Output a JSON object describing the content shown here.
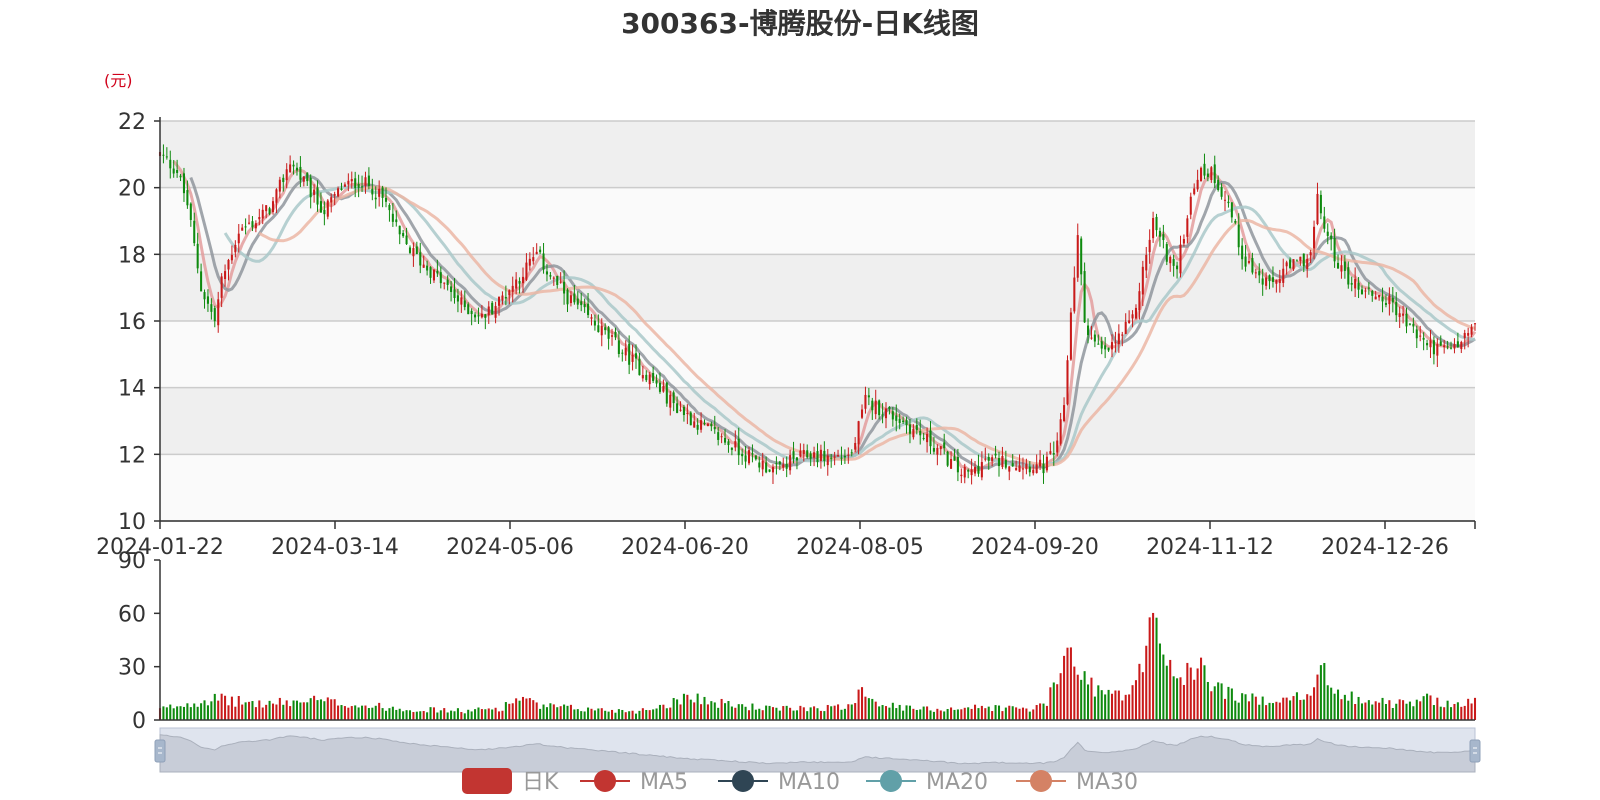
{
  "chart_data": {
    "type": "candlestick",
    "title": "300363-博腾股份-日K线图",
    "unit": "(元)",
    "colors": {
      "up": "#c91a1a",
      "down": "#0e8a0e",
      "ma5": "#e39c9c",
      "ma10": "#8f959c",
      "ma20": "#a9c8c9",
      "ma30": "#ebb6a4"
    },
    "price_axis": {
      "min": 10,
      "max": 22,
      "ticks": [
        10,
        12,
        14,
        16,
        18,
        20,
        22
      ]
    },
    "volume_axis": {
      "min": 0,
      "max": 90,
      "ticks": [
        0,
        30,
        60,
        90
      ]
    },
    "date_ticks": [
      "2024-01-22",
      "2024-03-14",
      "2024-05-06",
      "2024-06-20",
      "2024-08-05",
      "2024-09-20",
      "2024-11-12",
      "2024-12-26"
    ],
    "legend": [
      {
        "name": "日K",
        "color": "#c23531",
        "kind": "bar"
      },
      {
        "name": "MA5",
        "color": "#c23531",
        "kind": "line"
      },
      {
        "name": "MA10",
        "color": "#2f4554",
        "kind": "line"
      },
      {
        "name": "MA20",
        "color": "#61a0a8",
        "kind": "line"
      },
      {
        "name": "MA30",
        "color": "#d48265",
        "kind": "line"
      }
    ],
    "closes_anchor": [
      [
        0,
        21.0
      ],
      [
        5,
        20.5
      ],
      [
        8,
        19.5
      ],
      [
        12,
        17.0
      ],
      [
        16,
        16.0
      ],
      [
        18,
        17.2
      ],
      [
        23,
        18.7
      ],
      [
        28,
        19.0
      ],
      [
        33,
        19.5
      ],
      [
        38,
        20.8
      ],
      [
        43,
        20.0
      ],
      [
        48,
        19.3
      ],
      [
        53,
        20.0
      ],
      [
        58,
        20.2
      ],
      [
        62,
        20.0
      ],
      [
        66,
        19.5
      ],
      [
        70,
        18.5
      ],
      [
        76,
        17.8
      ],
      [
        82,
        17.2
      ],
      [
        88,
        16.5
      ],
      [
        94,
        16.1
      ],
      [
        99,
        16.6
      ],
      [
        104,
        17.2
      ],
      [
        110,
        18.0
      ],
      [
        115,
        17.2
      ],
      [
        120,
        16.6
      ],
      [
        126,
        16.0
      ],
      [
        132,
        15.4
      ],
      [
        138,
        14.8
      ],
      [
        144,
        14.2
      ],
      [
        150,
        13.5
      ],
      [
        156,
        13.0
      ],
      [
        162,
        12.6
      ],
      [
        168,
        12.2
      ],
      [
        174,
        11.8
      ],
      [
        180,
        11.5
      ],
      [
        184,
        11.8
      ],
      [
        190,
        12.0
      ],
      [
        196,
        11.9
      ],
      [
        202,
        12.0
      ],
      [
        206,
        13.6
      ],
      [
        212,
        13.3
      ],
      [
        218,
        12.9
      ],
      [
        223,
        12.5
      ],
      [
        228,
        12.1
      ],
      [
        233,
        11.5
      ],
      [
        236,
        11.4
      ],
      [
        241,
        11.8
      ],
      [
        247,
        11.8
      ],
      [
        253,
        11.7
      ],
      [
        258,
        11.6
      ],
      [
        262,
        12.2
      ],
      [
        264,
        13.5
      ],
      [
        266,
        16.3
      ],
      [
        268,
        18.5
      ],
      [
        270,
        16.0
      ],
      [
        273,
        15.3
      ],
      [
        276,
        15.0
      ],
      [
        280,
        15.5
      ],
      [
        284,
        16.0
      ],
      [
        287,
        17.5
      ],
      [
        290,
        19.0
      ],
      [
        294,
        18.0
      ],
      [
        297,
        17.5
      ],
      [
        301,
        19.8
      ],
      [
        303,
        20.4
      ],
      [
        307,
        20.5
      ],
      [
        312,
        19.5
      ],
      [
        316,
        18.0
      ],
      [
        320,
        17.4
      ],
      [
        324,
        17.0
      ],
      [
        328,
        17.5
      ],
      [
        332,
        17.7
      ],
      [
        336,
        18.0
      ],
      [
        338,
        19.6
      ],
      [
        341,
        18.5
      ],
      [
        345,
        17.5
      ],
      [
        350,
        17.0
      ],
      [
        355,
        16.8
      ],
      [
        360,
        16.5
      ],
      [
        365,
        15.8
      ],
      [
        370,
        15.3
      ],
      [
        375,
        15.1
      ],
      [
        378,
        15.2
      ],
      [
        382,
        15.6
      ],
      [
        384,
        15.9
      ]
    ],
    "volume_anchor": [
      [
        0,
        6
      ],
      [
        15,
        12
      ],
      [
        30,
        9
      ],
      [
        45,
        11
      ],
      [
        60,
        8
      ],
      [
        75,
        6
      ],
      [
        90,
        5
      ],
      [
        100,
        7
      ],
      [
        105,
        13
      ],
      [
        110,
        8
      ],
      [
        125,
        6
      ],
      [
        140,
        5
      ],
      [
        150,
        10
      ],
      [
        155,
        15
      ],
      [
        160,
        10
      ],
      [
        170,
        8
      ],
      [
        180,
        6
      ],
      [
        190,
        7
      ],
      [
        200,
        7
      ],
      [
        205,
        18
      ],
      [
        209,
        11
      ],
      [
        215,
        7
      ],
      [
        225,
        6
      ],
      [
        235,
        7
      ],
      [
        245,
        7
      ],
      [
        255,
        6
      ],
      [
        259,
        10
      ],
      [
        263,
        27
      ],
      [
        266,
        43
      ],
      [
        270,
        23
      ],
      [
        275,
        16
      ],
      [
        282,
        13
      ],
      [
        287,
        30
      ],
      [
        290,
        58
      ],
      [
        294,
        35
      ],
      [
        298,
        22
      ],
      [
        303,
        30
      ],
      [
        307,
        22
      ],
      [
        312,
        15
      ],
      [
        320,
        11
      ],
      [
        328,
        13
      ],
      [
        336,
        12
      ],
      [
        338,
        30
      ],
      [
        342,
        20
      ],
      [
        348,
        13
      ],
      [
        355,
        10
      ],
      [
        365,
        9
      ],
      [
        370,
        12
      ],
      [
        378,
        9
      ],
      [
        384,
        10
      ]
    ],
    "n_days": 385
  }
}
